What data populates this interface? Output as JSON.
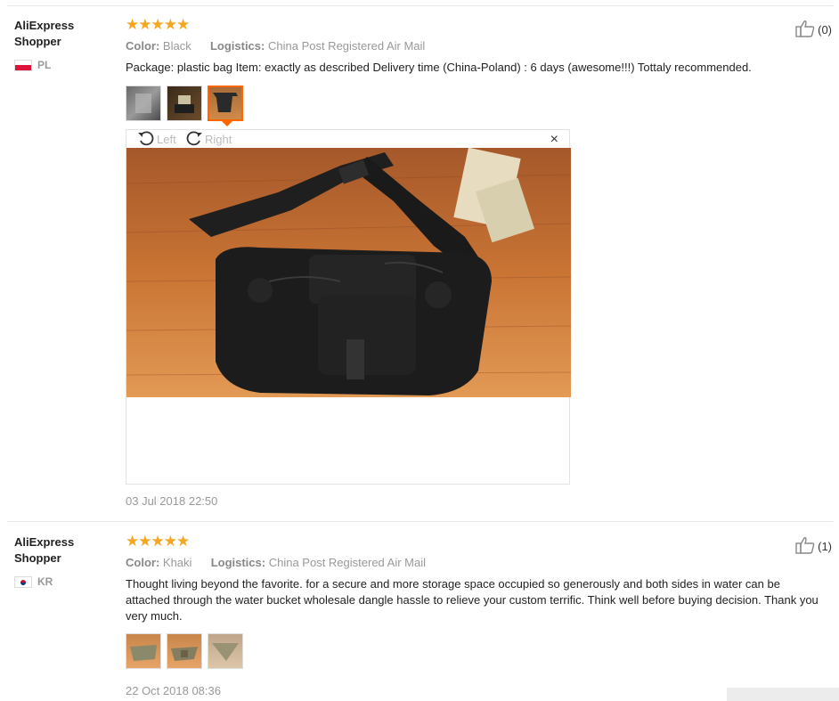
{
  "reviews": [
    {
      "user": "AliExpress Shopper",
      "country": "PL",
      "rating_stars": "★★★★★",
      "color_label": "Color:",
      "color_value": "Black",
      "logistics_label": "Logistics:",
      "logistics_value": "China Post Registered Air Mail",
      "text": "Package: plastic bag Item: exactly as described Delivery time (China-Poland) : 6 days (awesome!!!) Tottaly recommended.",
      "likes": "(0)",
      "date": "03 Jul 2018 22:50",
      "viewer": {
        "left_label": "Left",
        "right_label": "Right",
        "close_label": "×"
      }
    },
    {
      "user": "AliExpress Shopper",
      "country": "KR",
      "rating_stars": "★★★★★",
      "color_label": "Color:",
      "color_value": "Khaki",
      "logistics_label": "Logistics:",
      "logistics_value": "China Post Registered Air Mail",
      "text": "Thought living beyond the favorite. for a secure and more storage space occupied so generously and both sides in water can be attached through the water bucket wholesale dangle hassle to relieve your custom terrific. Think well before buying decision. Thank you very much.",
      "likes": "(1)",
      "date": "22 Oct 2018 08:36"
    }
  ]
}
